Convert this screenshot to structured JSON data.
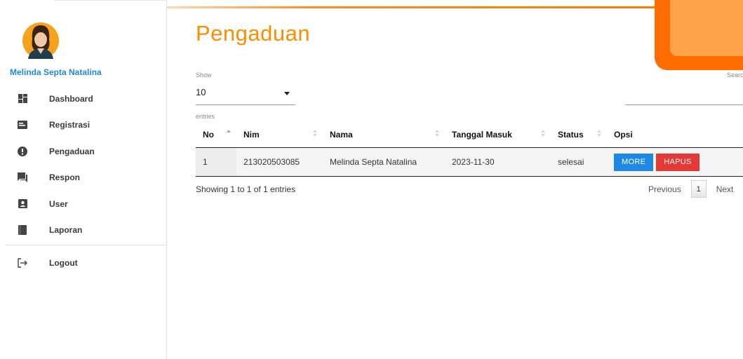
{
  "sidebar": {
    "user_name": "Melinda Septa Natalina",
    "items": [
      {
        "label": "Dashboard",
        "icon": "dashboard-icon"
      },
      {
        "label": "Registrasi",
        "icon": "registration-card-icon"
      },
      {
        "label": "Pengaduan",
        "icon": "alert-icon"
      },
      {
        "label": "Respon",
        "icon": "chat-icon"
      },
      {
        "label": "User",
        "icon": "user-box-icon"
      },
      {
        "label": "Laporan",
        "icon": "book-icon"
      }
    ],
    "logout": {
      "label": "Logout",
      "icon": "logout-icon"
    }
  },
  "main": {
    "title": "Pengaduan",
    "show_label": "Show",
    "page_length": "10",
    "entries_label": "entries",
    "search_label": "Search:"
  },
  "table": {
    "headers": [
      "No",
      "Nim",
      "Nama",
      "Tanggal Masuk",
      "Status",
      "Opsi"
    ],
    "rows": [
      {
        "no": "1",
        "nim": "213020503085",
        "nama": "Melinda Septa Natalina",
        "tanggal": "2023-11-30",
        "status": "selesai",
        "more": "MORE",
        "hapus": "HAPUS"
      }
    ],
    "info": "Showing 1 to 1 of 1 entries",
    "pager": {
      "previous": "Previous",
      "current": "1",
      "next": "Next"
    }
  },
  "colors": {
    "accent": "#ff8c00",
    "primary": "#1e88e5",
    "danger": "#e53935"
  }
}
